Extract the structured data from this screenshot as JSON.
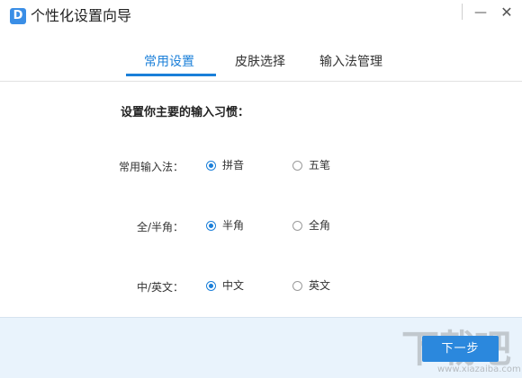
{
  "window": {
    "title": "个性化设置向导",
    "logo_letter": "D",
    "minimize_glyph": "—",
    "close_glyph": "✕"
  },
  "tabs": [
    {
      "label": "常用设置",
      "active": true
    },
    {
      "label": "皮肤选择",
      "active": false
    },
    {
      "label": "输入法管理",
      "active": false
    }
  ],
  "section_title": "设置你主要的输入习惯：",
  "settings": [
    {
      "label": "常用输入法：",
      "options": [
        {
          "label": "拼音",
          "checked": true
        },
        {
          "label": "五笔",
          "checked": false
        }
      ]
    },
    {
      "label": "全/半角：",
      "options": [
        {
          "label": "半角",
          "checked": true
        },
        {
          "label": "全角",
          "checked": false
        }
      ]
    },
    {
      "label": "中/英文：",
      "options": [
        {
          "label": "中文",
          "checked": true
        },
        {
          "label": "英文",
          "checked": false
        }
      ]
    }
  ],
  "footer": {
    "next_label": "下一步"
  },
  "watermark": {
    "text": "下载吧",
    "sub": "www.xiazaiba.com"
  },
  "colors": {
    "accent": "#1a7fd9",
    "footer_bg": "#e9f3fc",
    "button_bg": "#2b88dd"
  }
}
